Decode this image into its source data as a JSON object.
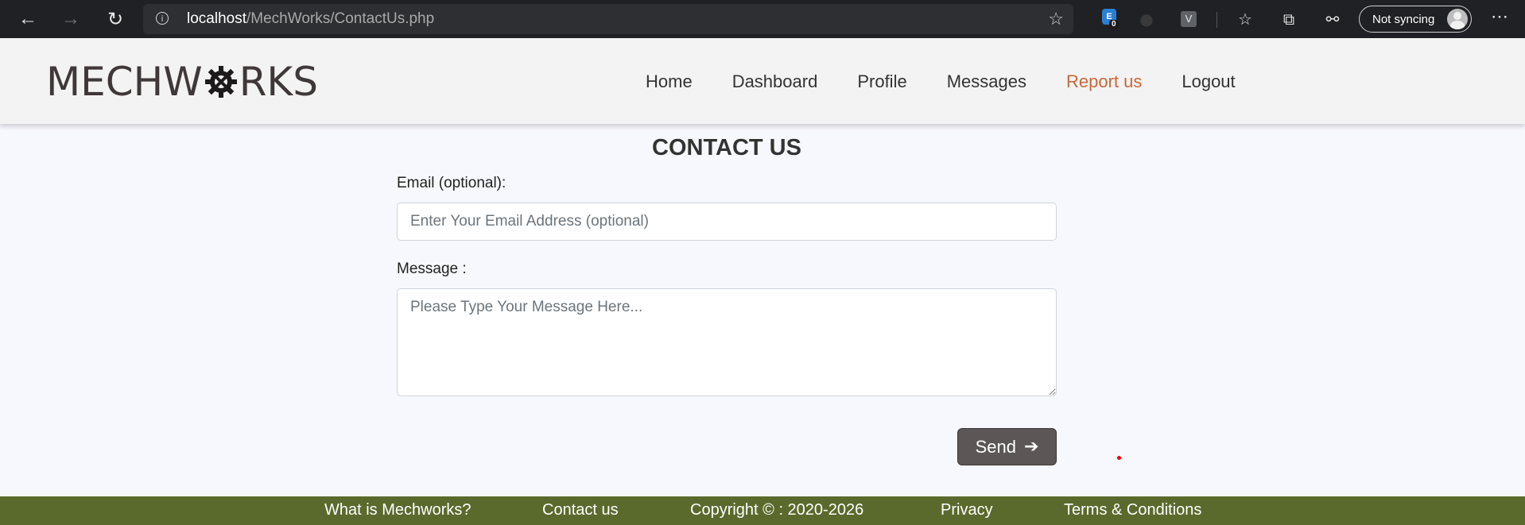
{
  "browser": {
    "url_host": "localhost",
    "url_path": "/MechWorks/ContactUs.php",
    "extension_badge_count": "0",
    "extension_letter": "V",
    "sync_label": "Not syncing"
  },
  "header": {
    "logo_prefix": "MECHW",
    "logo_suffix": "RKS",
    "nav": [
      {
        "label": "Home"
      },
      {
        "label": "Dashboard"
      },
      {
        "label": "Profile"
      },
      {
        "label": "Messages"
      },
      {
        "label": "Report us"
      },
      {
        "label": "Logout"
      }
    ],
    "active_color": "#c8673a"
  },
  "form": {
    "title": "CONTACT US",
    "email_label": "Email (optional):",
    "email_placeholder": "Enter Your Email Address (optional)",
    "email_value": "",
    "message_label": "Message :",
    "message_placeholder": "Please Type Your Message Here...",
    "message_value": "",
    "send_label": "Send"
  },
  "footer": {
    "items": [
      {
        "label": "What is Mechworks?"
      },
      {
        "label": "Contact us"
      },
      {
        "label": "Copyright © : 2020-2026"
      },
      {
        "label": "Privacy"
      },
      {
        "label": "Terms & Conditions"
      }
    ],
    "background": "#5a6a2c"
  }
}
